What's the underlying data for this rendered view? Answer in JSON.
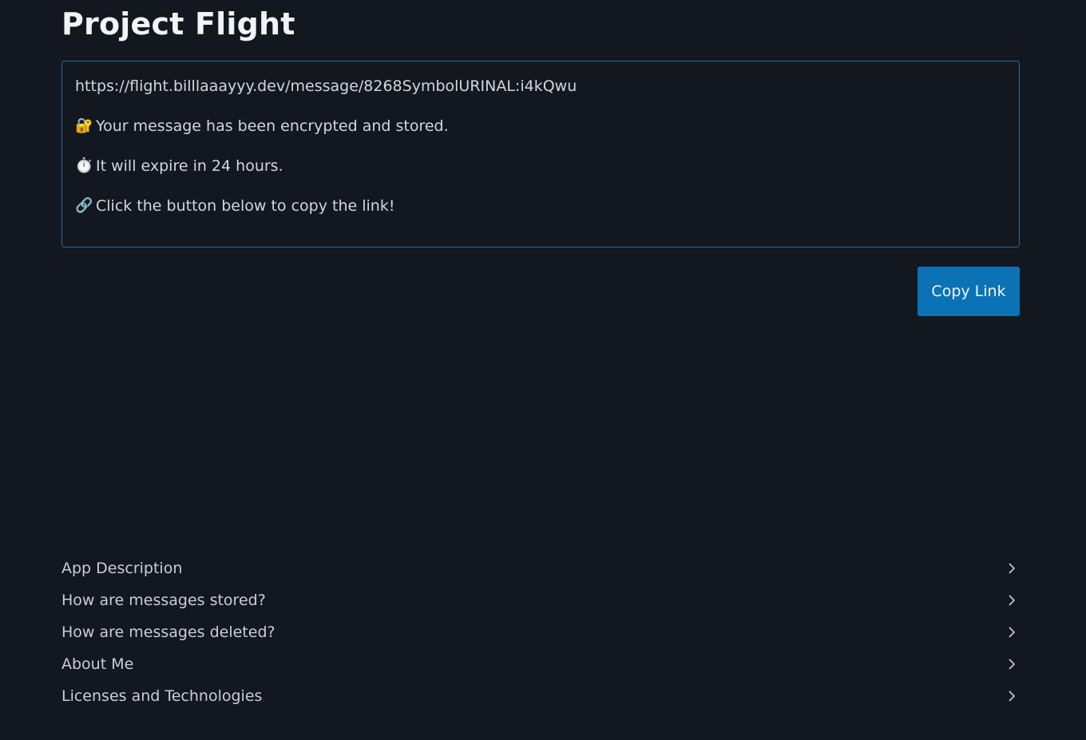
{
  "header": {
    "title": "Project Flight"
  },
  "message_box": {
    "link": "https://flight.billlaaayyy.dev/message/8268SymbolURINAL:i4kQwu",
    "lines": [
      {
        "icon": "locked-with-key-icon",
        "glyph": "🔐",
        "text": "Your message has been encrypted and stored."
      },
      {
        "icon": "stopwatch-icon",
        "glyph": "⏱️",
        "text": "It will expire in 24 hours."
      },
      {
        "icon": "link-icon",
        "glyph": "🔗",
        "text": "Click the button below to copy the link!"
      }
    ]
  },
  "actions": {
    "copy_label": "Copy Link"
  },
  "accordion": {
    "items": [
      {
        "label": "App Description"
      },
      {
        "label": "How are messages stored?"
      },
      {
        "label": "How are messages deleted?"
      },
      {
        "label": "About Me"
      },
      {
        "label": "Licenses and Technologies"
      }
    ]
  },
  "colors": {
    "background": "#131720",
    "accent": "#0b72b5",
    "box_border": "#1f6d9c"
  }
}
